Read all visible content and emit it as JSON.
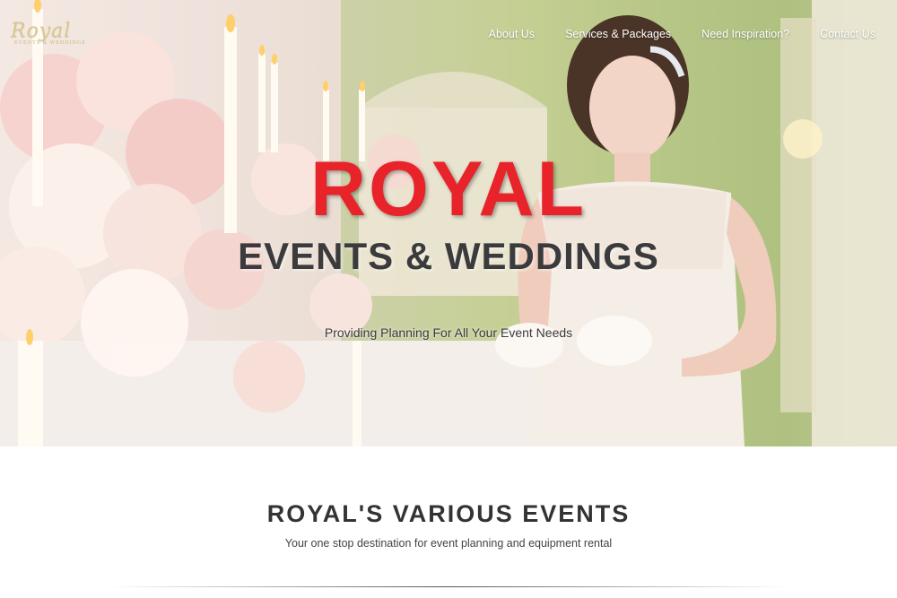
{
  "brand": {
    "logo_script": "Royal",
    "logo_sub": "EVENTS & WEDDINGS"
  },
  "nav": {
    "items": [
      "About Us",
      "Services & Packages",
      "Need Inspiration?",
      "Contact Us"
    ]
  },
  "hero": {
    "title": "ROYAL",
    "subtitle": "EVENTS & WEDDINGS",
    "tagline": "Providing Planning For All Your Event Needs"
  },
  "section": {
    "title": "ROYAL'S VARIOUS EVENTS",
    "subtitle": "Your one stop destination for event planning and equipment rental"
  },
  "colors": {
    "title_red": "#e8232a",
    "title_dark": "#3b3b3d",
    "wall_green": "#a8bb7c"
  }
}
